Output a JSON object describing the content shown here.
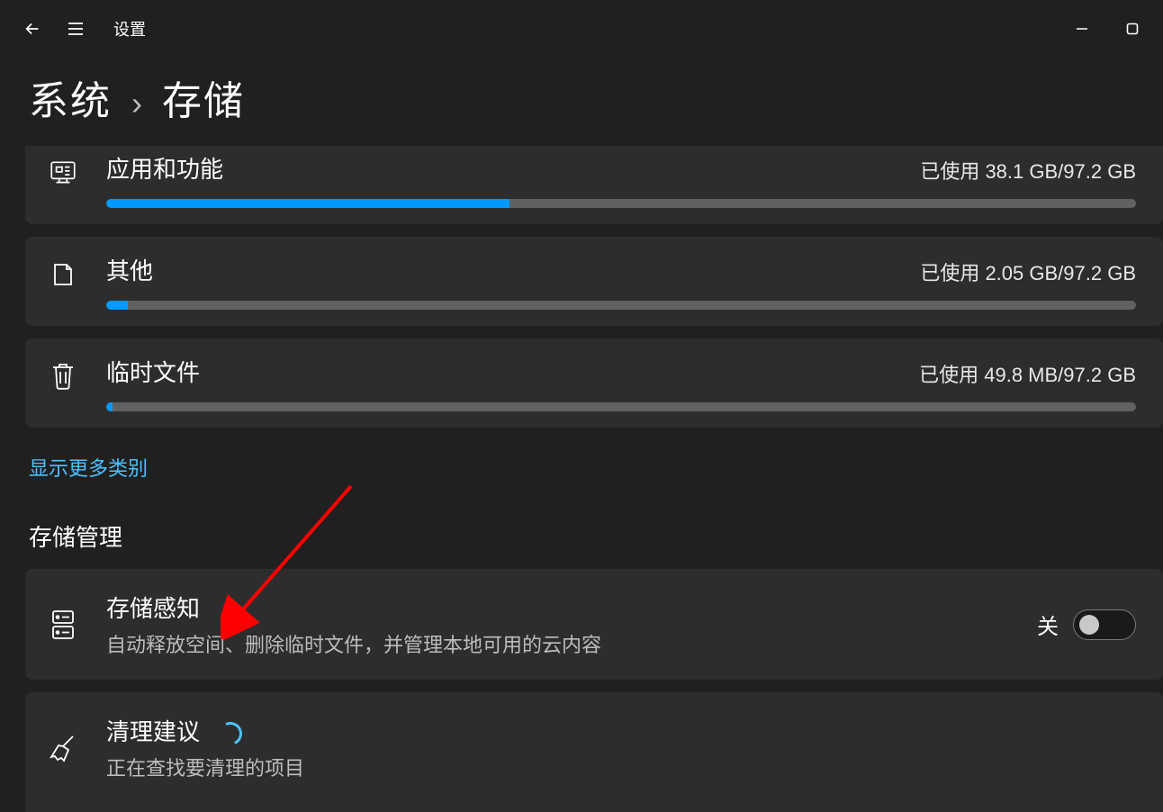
{
  "app_title": "设置",
  "breadcrumb": {
    "parent": "系统",
    "separator": "›",
    "current": "存储"
  },
  "categories": [
    {
      "key": "apps",
      "title": "应用和功能",
      "usage": "已使用 38.1 GB/97.2 GB",
      "fill_percent": 39
    },
    {
      "key": "other",
      "title": "其他",
      "usage": "已使用 2.05 GB/97.2 GB",
      "fill_percent": 2.1
    },
    {
      "key": "temp",
      "title": "临时文件",
      "usage": "已使用 49.8 MB/97.2 GB",
      "fill_percent": 0.5
    }
  ],
  "show_more_link": "显示更多类别",
  "management_heading": "存储管理",
  "storage_sense": {
    "title": "存储感知",
    "desc": "自动释放空间、删除临时文件，并管理本地可用的云内容",
    "state_label": "关",
    "on": false
  },
  "cleanup": {
    "title": "清理建议",
    "desc": "正在查找要清理的项目"
  }
}
